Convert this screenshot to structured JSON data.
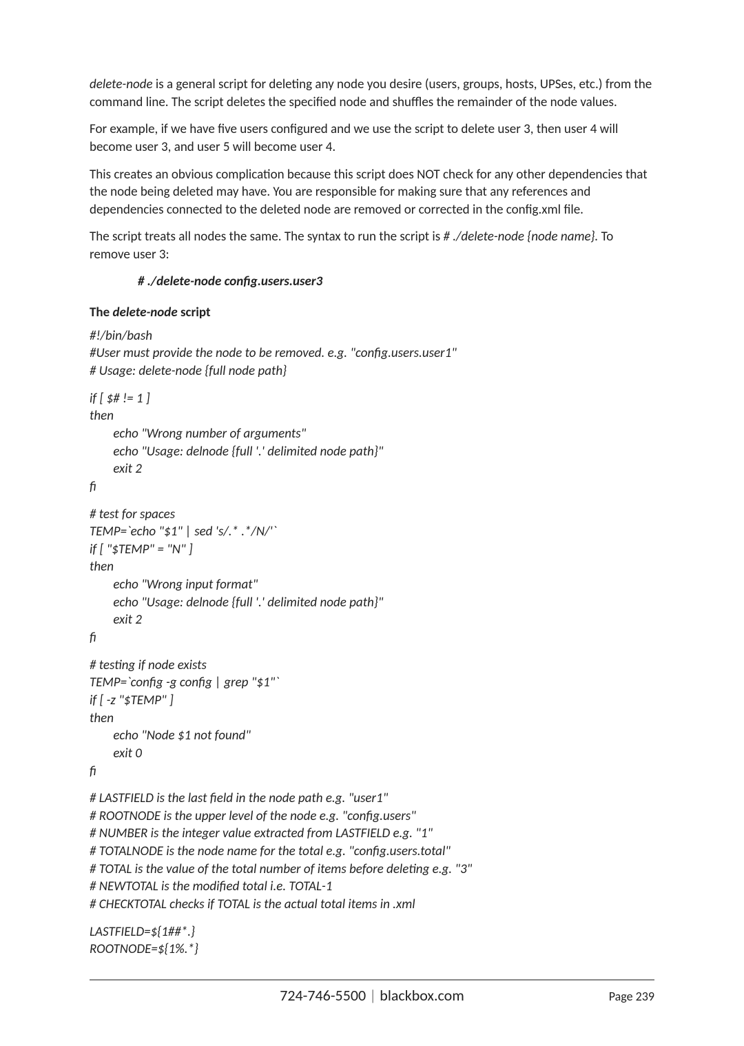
{
  "para1": {
    "pre_i": "delete-node",
    "post": " is a general script for deleting any node you desire (users, groups, hosts, UPSes, etc.) from the command line. The script deletes the specified node and shuffles the remainder of the node values."
  },
  "para2": "For example, if we have five users configured and we use the script to delete user 3, then user 4 will become user 3, and user 5 will become user 4.",
  "para3": "This creates an obvious complication because this script does NOT check for any other dependencies that the node being deleted may have. You are responsible for making sure that any references and dependencies connected to the deleted node are removed or corrected in the config.xml file.",
  "para4": {
    "a": "The script treats all nodes the same. The syntax to run the script is ",
    "i": "# ./delete-node {node name}.",
    "b": " To remove user 3:"
  },
  "cmd": "# ./delete-node config.users.user3",
  "heading": {
    "a": "The ",
    "i": "delete-node",
    "b": " script"
  },
  "script_block1": "#!/bin/bash\n#User must provide the node to be removed. e.g. \"config.users.user1\"\n# Usage: delete-node {full node path}",
  "script_block2": "if [ $# != 1 ]\nthen\n        echo \"Wrong number of arguments\"\n        echo \"Usage: delnode {full '.' delimited node path}\"\n        exit 2\nfi",
  "script_block3": "# test for spaces\nTEMP=`echo \"$1\" | sed 's/.* .*/N/'`\nif [ \"$TEMP\" = \"N\" ]\nthen\n        echo \"Wrong input format\"\n        echo \"Usage: delnode {full '.' delimited node path}\"\n        exit 2\nfi",
  "script_block4": "# testing if node exists\nTEMP=`config -g config | grep \"$1\"`\nif [ -z \"$TEMP\" ]\nthen\n        echo \"Node $1 not found\"\n        exit 0\nfi",
  "script_block5": "# LASTFIELD is the last field in the node path e.g. \"user1\"\n# ROOTNODE is the upper level of the node e.g. \"config.users\"\n# NUMBER is the integer value extracted from LASTFIELD e.g. \"1\"\n# TOTALNODE is the node name for the total e.g. \"config.users.total\"\n# TOTAL is the value of the total number of items before deleting e.g. \"3\"\n# NEWTOTAL is the modified total i.e. TOTAL-1\n# CHECKTOTAL checks if TOTAL is the actual total items in .xml",
  "script_block6": "LASTFIELD=${1##*.}\nROOTNODE=${1%.*}",
  "footer": {
    "center_a": "724-746-5500 ",
    "center_sep": "|",
    "center_b": " blackbox.com",
    "right_label": "Page ",
    "right_num": "239"
  }
}
